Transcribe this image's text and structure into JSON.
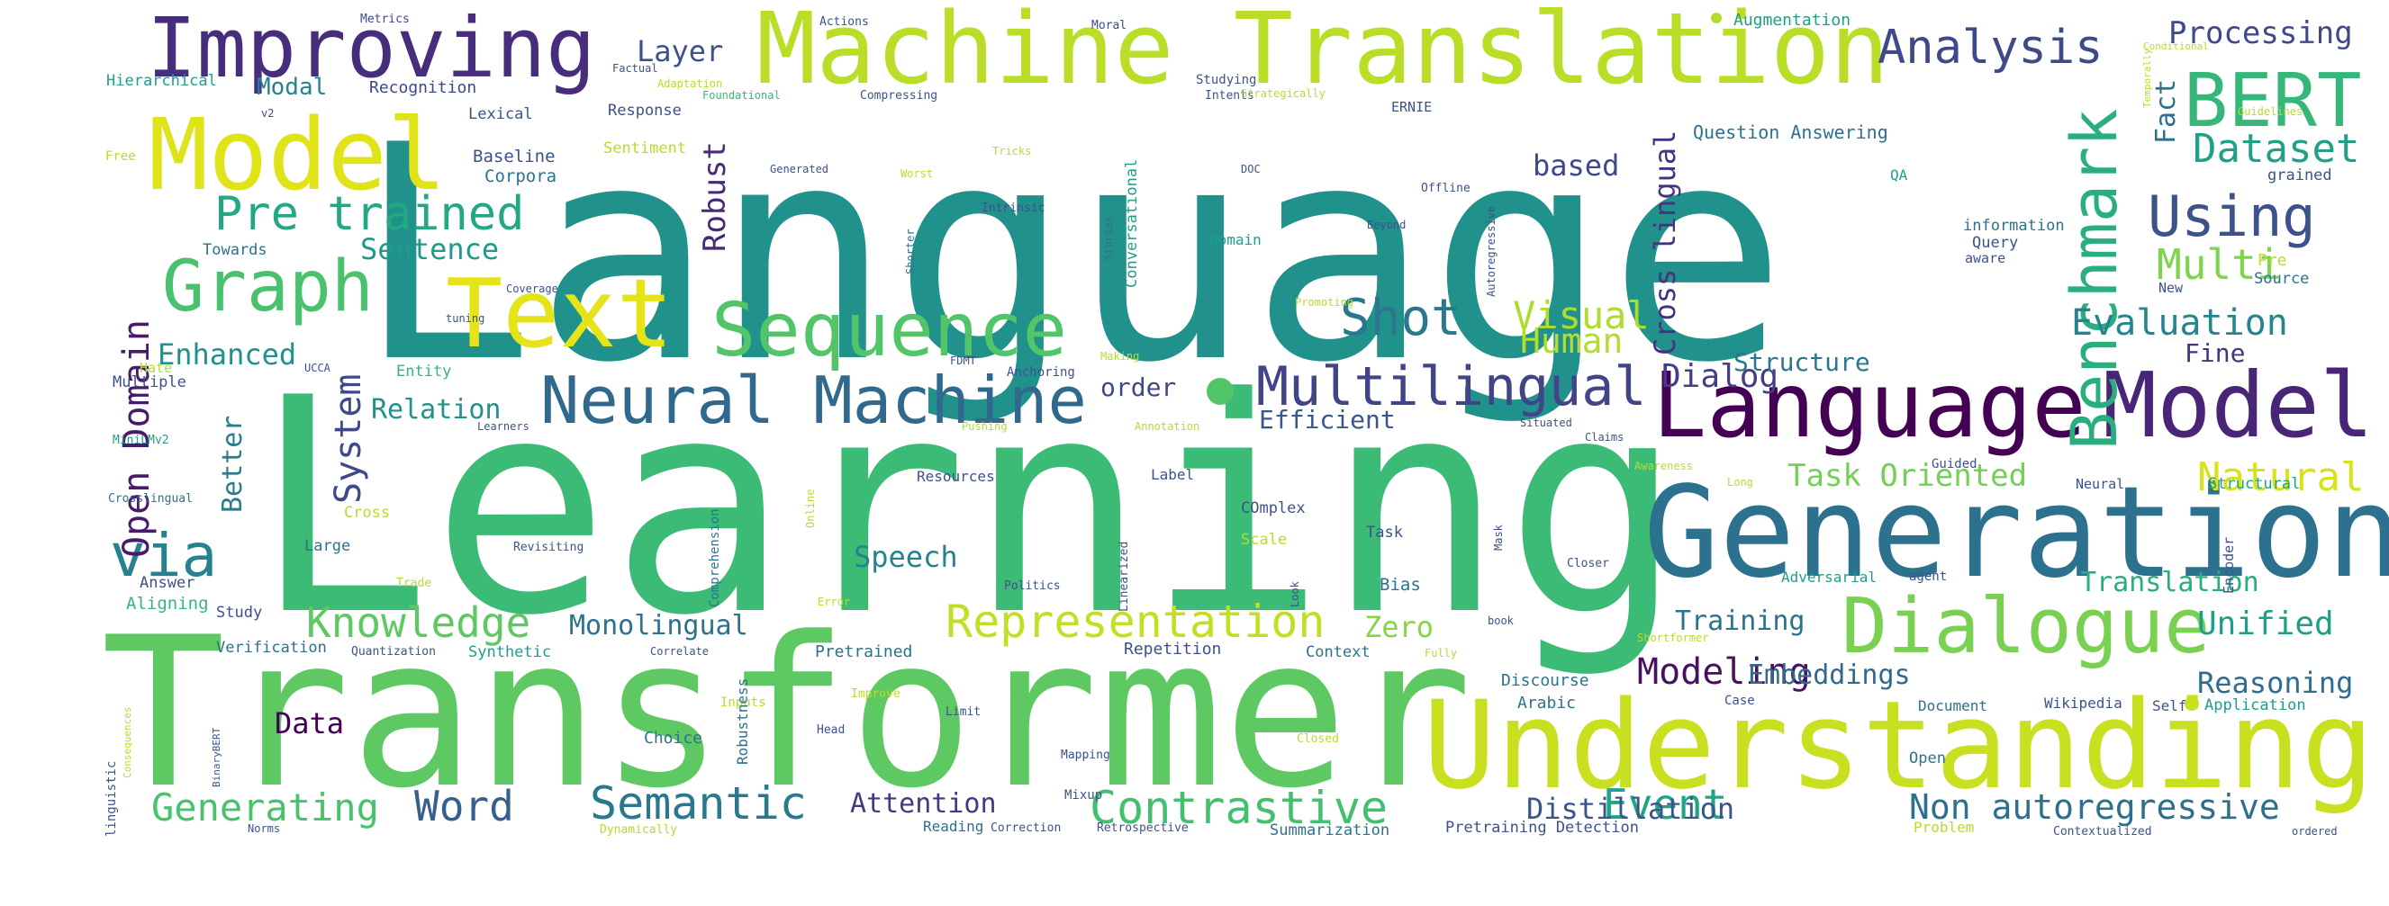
{
  "cloud": {
    "words": [
      {
        "text": "Language",
        "color": "#21918c"
      },
      {
        "text": "Learning",
        "color": "#3bbb75"
      },
      {
        "text": "Transformer",
        "color": "#5ec962"
      },
      {
        "text": "Machine Translation",
        "color": "#bade28"
      },
      {
        "text": "Understanding",
        "color": "#c8e020"
      },
      {
        "text": "Generation",
        "color": "#2c728e"
      },
      {
        "text": "Language",
        "color": "#440154"
      },
      {
        "text": "Model",
        "color": "#dfe318"
      },
      {
        "text": "Model",
        "color": "#482576"
      },
      {
        "text": "Improving",
        "color": "#472d7b"
      },
      {
        "text": "Text",
        "color": "#e5e419"
      },
      {
        "text": "Graph",
        "color": "#4ac16d"
      },
      {
        "text": "Sequence",
        "color": "#52c569"
      },
      {
        "text": "Neural Machine",
        "color": "#31688e"
      },
      {
        "text": "Dialogue",
        "color": "#7ad151"
      },
      {
        "text": "BERT",
        "color": "#35b779"
      },
      {
        "text": "Using",
        "color": "#3b528b"
      },
      {
        "text": "Benchmark",
        "color": "#29af7f"
      },
      {
        "text": "Multilingual",
        "color": "#414487"
      },
      {
        "text": "Representation",
        "color": "#c2df23"
      },
      {
        "text": "via",
        "color": "#26828e"
      },
      {
        "text": "Knowledge",
        "color": "#5ec962"
      },
      {
        "text": "Contrastive",
        "color": "#44bf70"
      },
      {
        "text": "Semantic",
        "color": "#2a788e"
      },
      {
        "text": "Word",
        "color": "#355f8d"
      },
      {
        "text": "Generating",
        "color": "#4ac16d"
      },
      {
        "text": "Pre trained",
        "color": "#22a884"
      },
      {
        "text": "Analysis",
        "color": "#3e4989"
      },
      {
        "text": "Open Domain",
        "color": "#481a6c"
      },
      {
        "text": "Shot",
        "color": "#2a788e"
      },
      {
        "text": "Dataset",
        "color": "#1fa088"
      },
      {
        "text": "Dialog",
        "color": "#433e85"
      },
      {
        "text": "Evaluation",
        "color": "#25858e"
      },
      {
        "text": "Natural",
        "color": "#d8e219"
      },
      {
        "text": "Unified",
        "color": "#1f9e89"
      },
      {
        "text": "Modeling",
        "color": "#471063"
      },
      {
        "text": "Event",
        "color": "#20a486"
      },
      {
        "text": "Non autoregressive",
        "color": "#2d708e"
      },
      {
        "text": "Distillation",
        "color": "#39568c"
      },
      {
        "text": "Processing",
        "color": "#3e4a89"
      },
      {
        "text": "Multi",
        "color": "#7fd34e"
      },
      {
        "text": "Visual",
        "color": "#addc30"
      },
      {
        "text": "Human",
        "color": "#b5de2b"
      },
      {
        "text": "Cross lingual",
        "color": "#46337f"
      },
      {
        "text": "Robust",
        "color": "#482878"
      },
      {
        "text": "Layer",
        "color": "#3b528b"
      },
      {
        "text": "based",
        "color": "#3e4989"
      },
      {
        "text": "Fact",
        "color": "#2d708e"
      },
      {
        "text": "System",
        "color": "#3e4989"
      },
      {
        "text": "Sentence",
        "color": "#1f9a8a"
      },
      {
        "text": "Enhanced",
        "color": "#20928c"
      },
      {
        "text": "Relation",
        "color": "#21918c"
      },
      {
        "text": "Better",
        "color": "#287c8e"
      },
      {
        "text": "Efficient",
        "color": "#39568c"
      },
      {
        "text": "order",
        "color": "#3f4788"
      },
      {
        "text": "Structure",
        "color": "#2a788e"
      },
      {
        "text": "Fine",
        "color": "#46327e"
      },
      {
        "text": "Task Oriented",
        "color": "#73d056"
      },
      {
        "text": "Translation",
        "color": "#27ad81"
      },
      {
        "text": "Speech",
        "color": "#26828e"
      },
      {
        "text": "Monolingual",
        "color": "#2c718e"
      },
      {
        "text": "Zero",
        "color": "#86d549"
      },
      {
        "text": "Training",
        "color": "#2c728e"
      },
      {
        "text": "Reasoning",
        "color": "#2f6c8e"
      },
      {
        "text": "Embeddings",
        "color": "#31688e"
      },
      {
        "text": "Attention",
        "color": "#443983"
      },
      {
        "text": "Data",
        "color": "#440154"
      },
      {
        "text": "Modal",
        "color": "#26828e"
      },
      {
        "text": "Recognition",
        "color": "#3e4989"
      },
      {
        "text": "Hierarchical",
        "color": "#1f9e89"
      },
      {
        "text": "Metrics",
        "color": "#3e4989"
      },
      {
        "text": "Actions",
        "color": "#3b528b"
      },
      {
        "text": "Moral",
        "color": "#3e4989"
      },
      {
        "text": "Augmentation",
        "color": "#1f9e89"
      },
      {
        "text": "Lexical",
        "color": "#3b528b"
      },
      {
        "text": "Baseline",
        "color": "#3b528b"
      },
      {
        "text": "Corpora",
        "color": "#2c728e"
      },
      {
        "text": "Towards",
        "color": "#2c728e"
      },
      {
        "text": "Response",
        "color": "#3b528b"
      },
      {
        "text": "Sentiment",
        "color": "#b5de2b"
      },
      {
        "text": "Question Answering",
        "color": "#2c728e"
      },
      {
        "text": "Conversational",
        "color": "#1f9e89"
      },
      {
        "text": "Compressing",
        "color": "#3b528b"
      },
      {
        "text": "Factual",
        "color": "#3b528b"
      },
      {
        "text": "Adaptation",
        "color": "#b5de2b"
      },
      {
        "text": "Foundational",
        "color": "#35b779"
      },
      {
        "text": "Studying",
        "color": "#3b528b"
      },
      {
        "text": "Intents",
        "color": "#3b528b"
      },
      {
        "text": "Strategically",
        "color": "#b5de2b"
      },
      {
        "text": "ERNIE",
        "color": "#3b528b"
      },
      {
        "text": "QA",
        "color": "#1f9e89"
      },
      {
        "text": "Conditional",
        "color": "#b5de2b"
      },
      {
        "text": "Guidelines",
        "color": "#b5de2b"
      },
      {
        "text": "grained",
        "color": "#3b528b"
      },
      {
        "text": "Temporally",
        "color": "#b5de2b"
      },
      {
        "text": "Pre",
        "color": "#b5de2b"
      },
      {
        "text": "Source",
        "color": "#2c728e"
      },
      {
        "text": "New",
        "color": "#3b528b"
      },
      {
        "text": "information",
        "color": "#2c728e"
      },
      {
        "text": "Query",
        "color": "#3b528b"
      },
      {
        "text": "aware",
        "color": "#3b528b"
      },
      {
        "text": "Autoregressive",
        "color": "#3b528b"
      },
      {
        "text": "Offline",
        "color": "#3b528b"
      },
      {
        "text": "Beyond",
        "color": "#3b528b"
      },
      {
        "text": "Intrinsic",
        "color": "#3b528b"
      },
      {
        "text": "Tricks",
        "color": "#b5de2b"
      },
      {
        "text": "Worst",
        "color": "#b5de2b"
      },
      {
        "text": "Generated",
        "color": "#3b528b"
      },
      {
        "text": "Stories",
        "color": "#2c728e"
      },
      {
        "text": "Shorter",
        "color": "#2c728e"
      },
      {
        "text": "DOC",
        "color": "#3b528b"
      },
      {
        "text": "Domain",
        "color": "#1f9e89"
      },
      {
        "text": "Promoting",
        "color": "#b5de2b"
      },
      {
        "text": "Coverage",
        "color": "#3b528b"
      },
      {
        "text": "tuning",
        "color": "#3b528b"
      },
      {
        "text": "Free",
        "color": "#b5de2b"
      },
      {
        "text": "v2",
        "color": "#3b528b"
      },
      {
        "text": "Hate",
        "color": "#b5de2b"
      },
      {
        "text": "UCCA",
        "color": "#3b528b"
      },
      {
        "text": "Multiple",
        "color": "#3b528b"
      },
      {
        "text": "Entity",
        "color": "#35b779"
      },
      {
        "text": "FDMT",
        "color": "#3b528b"
      },
      {
        "text": "Making",
        "color": "#b5de2b"
      },
      {
        "text": "Anchoring",
        "color": "#3b528b"
      },
      {
        "text": "Learners",
        "color": "#3b528b"
      },
      {
        "text": "MiniLMv2",
        "color": "#1f9e89"
      },
      {
        "text": "Crosslingual",
        "color": "#2c728e"
      },
      {
        "text": "Pushing",
        "color": "#b5de2b"
      },
      {
        "text": "Annotation",
        "color": "#b5de2b"
      },
      {
        "text": "Situated",
        "color": "#3b528b"
      },
      {
        "text": "Claims",
        "color": "#3b528b"
      },
      {
        "text": "Awareness",
        "color": "#b5de2b"
      },
      {
        "text": "Long",
        "color": "#b5de2b"
      },
      {
        "text": "Guided",
        "color": "#3b528b"
      },
      {
        "text": "Neural",
        "color": "#3b528b"
      },
      {
        "text": "Structural",
        "color": "#1f9e89"
      },
      {
        "text": "Encoder",
        "color": "#3b528b"
      },
      {
        "text": "Resources",
        "color": "#3b528b"
      },
      {
        "text": "Label",
        "color": "#3b528b"
      },
      {
        "text": "COmplex",
        "color": "#3b528b"
      },
      {
        "text": "Task",
        "color": "#3b528b"
      },
      {
        "text": "Mask",
        "color": "#3b528b"
      },
      {
        "text": "Cross",
        "color": "#b5de2b"
      },
      {
        "text": "Large",
        "color": "#2c728e"
      },
      {
        "text": "Online",
        "color": "#b5de2b"
      },
      {
        "text": "Comprehension",
        "color": "#2c728e"
      },
      {
        "text": "Linearized",
        "color": "#3b528b"
      },
      {
        "text": "Scale",
        "color": "#b5de2b"
      },
      {
        "text": "Look",
        "color": "#3b528b"
      },
      {
        "text": "Closer",
        "color": "#3b528b"
      },
      {
        "text": "Revisiting",
        "color": "#3b528b"
      },
      {
        "text": "Trade",
        "color": "#b5de2b"
      },
      {
        "text": "Politics",
        "color": "#3b528b"
      },
      {
        "text": "Bias",
        "color": "#2c728e"
      },
      {
        "text": "agent",
        "color": "#3b528b"
      },
      {
        "text": "Answer",
        "color": "#3b528b"
      },
      {
        "text": "Aligning",
        "color": "#35b779"
      },
      {
        "text": "Study",
        "color": "#3b528b"
      },
      {
        "text": "Error",
        "color": "#b5de2b"
      },
      {
        "text": "book",
        "color": "#3b528b"
      },
      {
        "text": "Verification",
        "color": "#2c728e"
      },
      {
        "text": "Quantization",
        "color": "#3b528b"
      },
      {
        "text": "Synthetic",
        "color": "#1f9e89"
      },
      {
        "text": "Correlate",
        "color": "#3b528b"
      },
      {
        "text": "Pretrained",
        "color": "#2c728e"
      },
      {
        "text": "Repetition",
        "color": "#3b528b"
      },
      {
        "text": "Context",
        "color": "#2c728e"
      },
      {
        "text": "Fully",
        "color": "#b5de2b"
      },
      {
        "text": "Shortformer",
        "color": "#b5de2b"
      },
      {
        "text": "Discourse",
        "color": "#2c728e"
      },
      {
        "text": "Arabic",
        "color": "#2c728e"
      },
      {
        "text": "Case",
        "color": "#3b528b"
      },
      {
        "text": "Document",
        "color": "#2c728e"
      },
      {
        "text": "Wikipedia",
        "color": "#3b528b"
      },
      {
        "text": "Self",
        "color": "#3b528b"
      },
      {
        "text": "Application",
        "color": "#1f9e89"
      },
      {
        "text": "linguistic",
        "color": "#3b528b"
      },
      {
        "text": "BinaryBERT",
        "color": "#3b528b"
      },
      {
        "text": "Consequences",
        "color": "#b5de2b"
      },
      {
        "text": "Inputs",
        "color": "#b5de2b"
      },
      {
        "text": "Improve",
        "color": "#b5de2b"
      },
      {
        "text": "Robustness",
        "color": "#2c728e"
      },
      {
        "text": "Limit",
        "color": "#3b528b"
      },
      {
        "text": "Head",
        "color": "#3b528b"
      },
      {
        "text": "Choice",
        "color": "#2c728e"
      },
      {
        "text": "Mapping",
        "color": "#3b528b"
      },
      {
        "text": "Closed",
        "color": "#b5de2b"
      },
      {
        "text": "Open",
        "color": "#2c728e"
      },
      {
        "text": "Problem",
        "color": "#b5de2b"
      },
      {
        "text": "Contextualized",
        "color": "#3b528b"
      },
      {
        "text": "ordered",
        "color": "#3b528b"
      },
      {
        "text": "Mixup",
        "color": "#3b528b"
      },
      {
        "text": "Reading",
        "color": "#2c728e"
      },
      {
        "text": "Correction",
        "color": "#3b528b"
      },
      {
        "text": "Retrospective",
        "color": "#3b528b"
      },
      {
        "text": "Summarization",
        "color": "#2c728e"
      },
      {
        "text": "Pretraining Detection",
        "color": "#3b528b"
      },
      {
        "text": "Norms",
        "color": "#3b528b"
      },
      {
        "text": "Dynamically",
        "color": "#b5de2b"
      },
      {
        "text": "Adversarial",
        "color": "#1f9e89"
      }
    ]
  }
}
